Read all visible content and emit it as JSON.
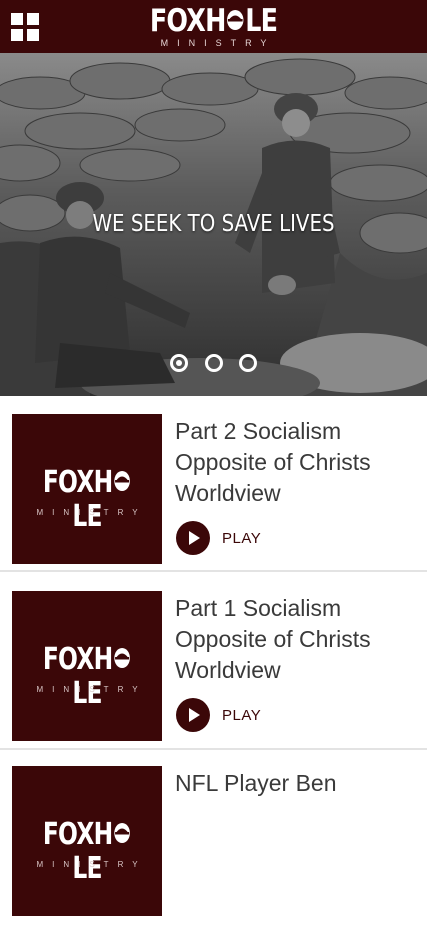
{
  "header": {
    "logo_word": "FOXHOLE",
    "logo_word_left": "FOXH",
    "logo_word_right": "LE",
    "logo_sub": "MINISTRY",
    "menu_icon": "grid-menu-icon",
    "color": "#3b0708"
  },
  "hero": {
    "caption": "WE SEEK TO SAVE LIVES",
    "slides_count": 3,
    "active_slide": 1
  },
  "items": [
    {
      "title": "Part 2 Socialism Opposite of Christs Worldview",
      "play_label": "PLAY",
      "thumb_word_left": "FOXH",
      "thumb_word_right": "LE",
      "thumb_sub": "MINISTRY"
    },
    {
      "title": "Part 1 Socialism Opposite of Christs Worldview",
      "play_label": "PLAY",
      "thumb_word_left": "FOXH",
      "thumb_word_right": "LE",
      "thumb_sub": "MINISTRY"
    },
    {
      "title": "NFL Player Ben",
      "thumb_word_left": "FOXH",
      "thumb_word_right": "LE",
      "thumb_sub": "MINISTRY"
    }
  ]
}
